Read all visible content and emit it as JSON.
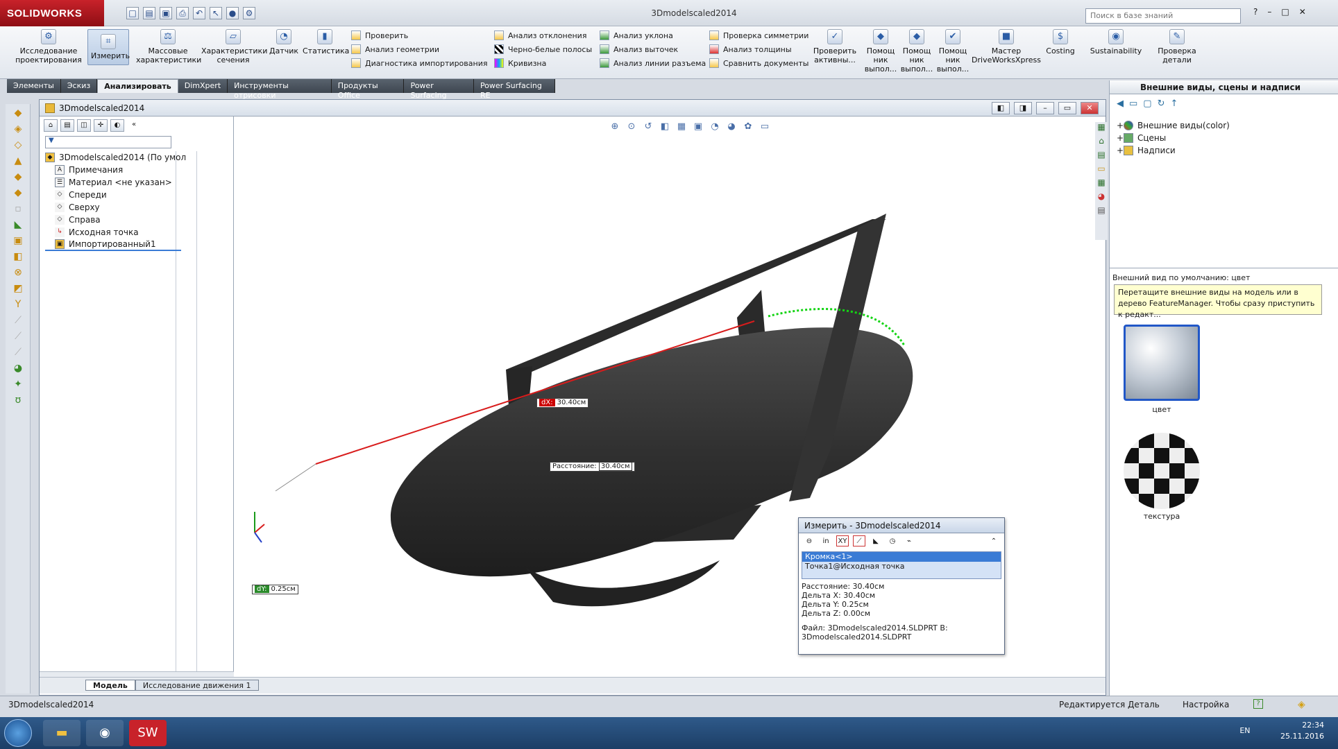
{
  "app": {
    "brand": "SOLIDWORKS",
    "doc_title": "3Dmodelscaled2014",
    "search_placeholder": "Поиск в базе знаний"
  },
  "ribbon": {
    "big": [
      {
        "label": "Исследование\nпроектирования"
      },
      {
        "label": "Измерить"
      },
      {
        "label": "Массовые\nхарактеристики"
      },
      {
        "label": "Характеристики\nсечения"
      },
      {
        "label": "Датчик"
      },
      {
        "label": "Статистика"
      }
    ],
    "col1": [
      "Проверить",
      "Анализ геометрии",
      "Диагностика импортирования"
    ],
    "col2": [
      "Анализ отклонения",
      "Черно-белые полосы",
      "Кривизна"
    ],
    "col3": [
      "Анализ уклона",
      "Анализ выточек",
      "Анализ линии разъема"
    ],
    "col4": [
      "Проверка симметрии",
      "Анализ толщины",
      "Сравнить документы"
    ],
    "right": [
      {
        "label": "Проверить\nактивны..."
      },
      {
        "label": "Помощ\nник\nвыпол..."
      },
      {
        "label": "Помощ\nник\nвыпол..."
      },
      {
        "label": "Помощ\nник\nвыпол..."
      },
      {
        "label": "Мастер\nDriveWorksXpress"
      },
      {
        "label": "Costing"
      },
      {
        "label": "Sustainability"
      },
      {
        "label": "Проверка\nдетали"
      }
    ]
  },
  "tabs": [
    "Элементы",
    "Эскиз",
    "Анализировать",
    "DimXpert",
    "Инструменты отрисовки",
    "Продукты Office",
    "Power Surfacing",
    "Power Surfacing RE"
  ],
  "tabs_active": 2,
  "doc": {
    "title": "3Dmodelscaled2014"
  },
  "tree": {
    "root": "3Dmodelscaled2014  (По умол",
    "items": [
      "Примечания",
      "Материал <не указан>",
      "Спереди",
      "Сверху",
      "Справа",
      "Исходная точка",
      "Импортированный1"
    ]
  },
  "bottom_tabs": [
    "Модель",
    "Исследование движения 1"
  ],
  "viewport": {
    "dx_key": "dX:",
    "dx_val": "30.40см",
    "dist_key": "Расстояние:",
    "dist_val": "30.40см",
    "dy_key": "dY:",
    "dy_val": "0.25см"
  },
  "measure": {
    "title": "Измерить - 3Dmodelscaled2014",
    "selections": [
      "Кромка<1>",
      "Точка1@Исходная точка"
    ],
    "results": [
      "Расстояние: 30.40см",
      "Дельта X: 30.40см",
      "Дельта Y: 0.25см",
      "Дельта Z: 0.00см"
    ],
    "file_line1": "Файл: 3Dmodelscaled2014.SLDPRT В:",
    "file_line2": "3Dmodelscaled2014.SLDPRT"
  },
  "right_panel": {
    "title": "Внешние виды, сцены и надписи",
    "tree": [
      "Внешние виды(color)",
      "Сцены",
      "Надписи"
    ],
    "default_label": "Внешний вид по умолчанию: цвет",
    "tip": "Перетащите внешние виды на модель или в дерево FeatureManager.  Чтобы сразу приступить к редакт...",
    "swatches": [
      "цвет",
      "текстура"
    ]
  },
  "status": {
    "left": "3Dmodelscaled2014",
    "mid": "Редактируется Деталь",
    "right": "Настройка"
  },
  "taskbar": {
    "lang": "EN",
    "time": "22:34",
    "date": "25.11.2016"
  }
}
